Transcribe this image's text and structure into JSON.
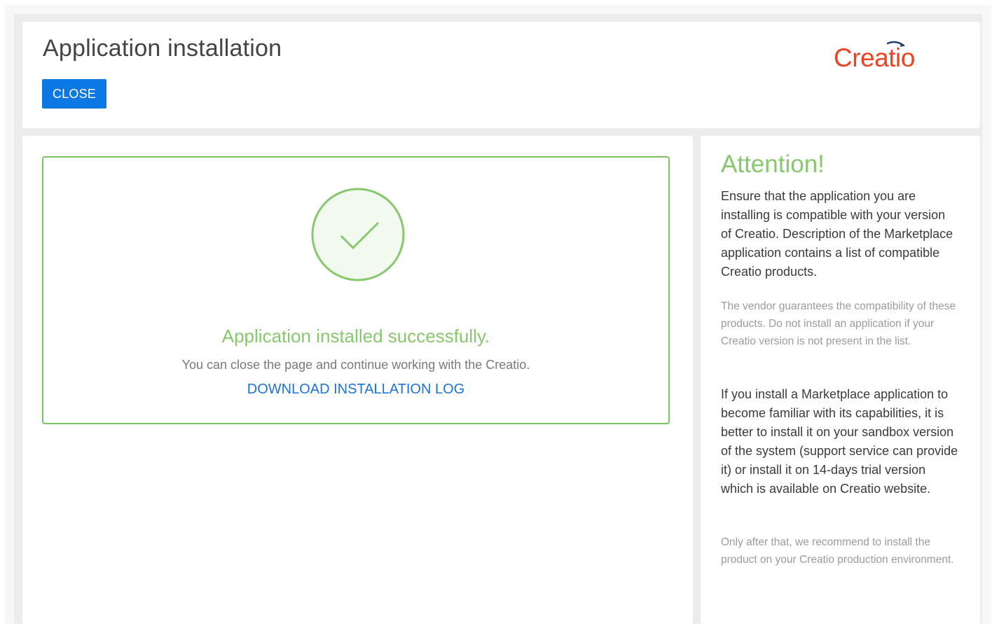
{
  "header": {
    "title": "Application installation",
    "close_label": "CLOSE",
    "logo_text": "Creatio",
    "logo_color": "#ee4323"
  },
  "main": {
    "status_icon": "check-circle-icon",
    "success_title": "Application installed successfully.",
    "success_subtitle": "You can close the page and continue working with the Creatio.",
    "download_link": "DOWNLOAD INSTALLATION LOG",
    "success_color": "#87c76d",
    "link_color": "#1b72d9"
  },
  "sidebar": {
    "title": "Attention!",
    "paragraph_1": "Ensure that the application you are installing is compatible with your version of Creatio. Description of the Marketplace application contains a list of compatible Creatio products.",
    "paragraph_2": "The vendor guarantees the compatibility of these products. Do not install an application if your Creatio version is not present in the list.",
    "paragraph_3": "If you install a Marketplace application to become familiar with its capabilities, it is better to install it on your sandbox version of the system (support service can provide it) or install it on 14-days trial version which is available on Creatio website.",
    "paragraph_4": "Only after that, we recommend to install the product on your Creatio production environment."
  },
  "colors": {
    "primary_button": "#0b78e3",
    "background": "#eaeced"
  }
}
